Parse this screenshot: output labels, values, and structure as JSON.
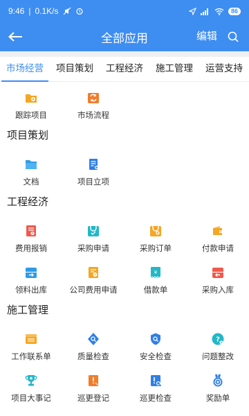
{
  "status_bar": {
    "time": "9:46",
    "speed": "0.1K/s",
    "battery": "86"
  },
  "app_bar": {
    "title": "全部应用",
    "edit_label": "编辑"
  },
  "tabs": [
    {
      "label": "市场经营",
      "active": true
    },
    {
      "label": "项目策划",
      "active": false
    },
    {
      "label": "工程经济",
      "active": false
    },
    {
      "label": "施工管理",
      "active": false
    },
    {
      "label": "运营支持",
      "active": false
    }
  ],
  "sections": {
    "market": {
      "title": "",
      "items": [
        {
          "label": "跟踪项目",
          "icon": "track-project-icon",
          "color": "#f5a623"
        },
        {
          "label": "市场流程",
          "icon": "market-process-icon",
          "color": "#f07d2c"
        }
      ]
    },
    "planning": {
      "title": "项目策划",
      "items": [
        {
          "label": "文档",
          "icon": "folder-icon",
          "color": "#2f9be6"
        },
        {
          "label": "项目立项",
          "icon": "project-approval-icon",
          "color": "#2f7fe6"
        }
      ]
    },
    "economy": {
      "title": "工程经济",
      "items": [
        {
          "label": "费用报销",
          "icon": "expense-claim-icon",
          "color": "#ef5a4c"
        },
        {
          "label": "采购申请",
          "icon": "purchase-request-icon",
          "color": "#22b8c8"
        },
        {
          "label": "采购订单",
          "icon": "purchase-order-icon",
          "color": "#f5a623"
        },
        {
          "label": "付款申请",
          "icon": "payment-request-icon",
          "color": "#f5a623"
        },
        {
          "label": "领料出库",
          "icon": "material-out-icon",
          "color": "#2f9be6"
        },
        {
          "label": "公司费用申请",
          "icon": "company-expense-icon",
          "color": "#f5a623"
        },
        {
          "label": "借款单",
          "icon": "loan-icon",
          "color": "#22b8c8"
        },
        {
          "label": "采购入库",
          "icon": "purchase-in-icon",
          "color": "#ef5a4c"
        }
      ]
    },
    "construction": {
      "title": "施工管理",
      "items": [
        {
          "label": "工作联系单",
          "icon": "work-contact-icon",
          "color": "#f5a623"
        },
        {
          "label": "质量检查",
          "icon": "quality-check-icon",
          "color": "#2f7fe6"
        },
        {
          "label": "安全检查",
          "icon": "safety-check-icon",
          "color": "#2f7fe6"
        },
        {
          "label": "问题整改",
          "icon": "issue-fix-icon",
          "color": "#22b8c8"
        },
        {
          "label": "项目大事记",
          "icon": "trophy-icon",
          "color": "#22b8c8"
        },
        {
          "label": "巡更登记",
          "icon": "patrol-register-icon",
          "color": "#f07d2c"
        },
        {
          "label": "巡更检查",
          "icon": "patrol-check-icon",
          "color": "#2f7fe6"
        },
        {
          "label": "奖励单",
          "icon": "award-icon",
          "color": "#2f7fe6"
        }
      ]
    }
  }
}
